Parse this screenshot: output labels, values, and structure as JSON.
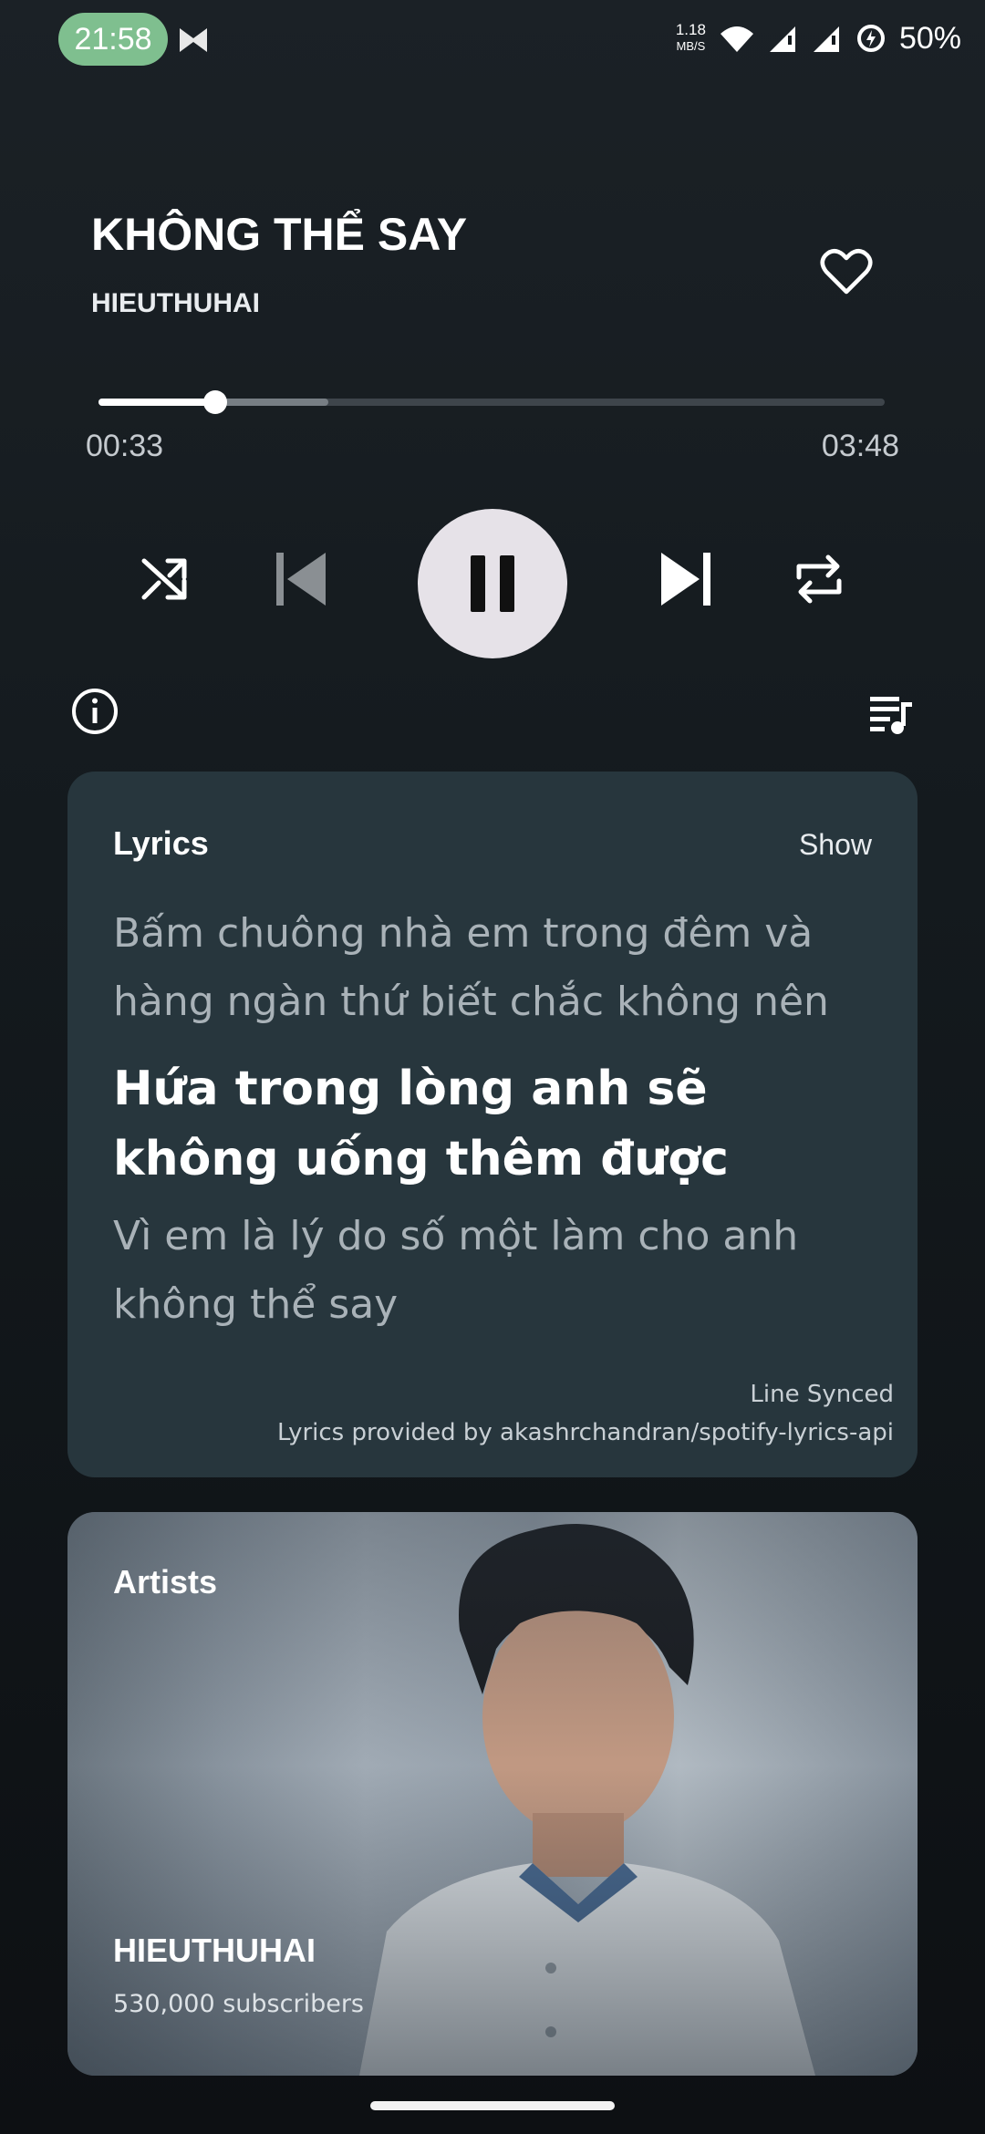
{
  "status_bar": {
    "time": "21:58",
    "net_speed_value": "1.18",
    "net_speed_unit": "MB/S",
    "battery": "50%"
  },
  "song": {
    "title": "KHÔNG THỂ SAY",
    "artist": "HIEUTHUHAI",
    "liked": false
  },
  "playback": {
    "elapsed": "00:33",
    "total": "03:48",
    "progress_fraction": 0.148,
    "buffered_fraction": 0.292,
    "state": "playing"
  },
  "controls": {
    "shuffle_icon": "shuffle-icon",
    "previous_icon": "skip-previous-icon",
    "play_pause_icon": "pause-icon",
    "next_icon": "skip-next-icon",
    "repeat_icon": "repeat-icon",
    "info_icon": "info-icon",
    "queue_icon": "queue-music-icon"
  },
  "lyrics": {
    "heading": "Lyrics",
    "toggle_label": "Show",
    "previous_line": "Bấm chuông nhà em trong đêm và hàng ngàn thứ biết chắc không nên",
    "current_line": "Hứa trong lòng anh sẽ không uống thêm được",
    "next_line": "Vì em là lý do số một làm cho anh không thể say",
    "sync_type": "Line Synced",
    "credit": "Lyrics provided by akashrchandran/spotify-lyrics-api"
  },
  "artists": {
    "heading": "Artists",
    "name": "HIEUTHUHAI",
    "subscribers": "530,000 subscribers"
  },
  "colors": {
    "status_pill": "#7fbf8f",
    "lyrics_card": "#27363d",
    "play_button": "#e6e2e8",
    "progress_fill": "#ffffff"
  }
}
